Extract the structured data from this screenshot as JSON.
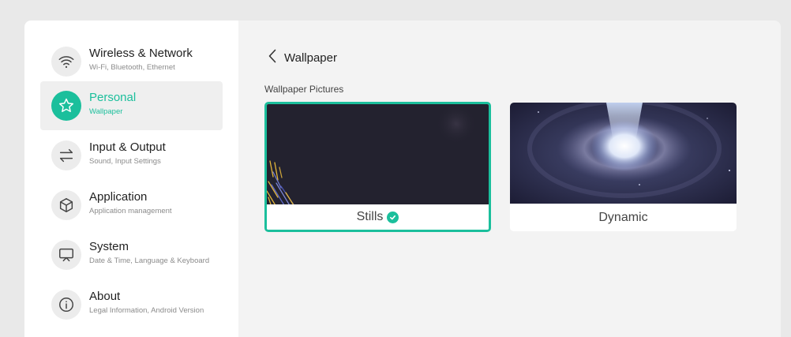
{
  "sidebar": {
    "items": [
      {
        "title": "Wireless & Network",
        "subtitle": "Wi-Fi, Bluetooth, Ethernet",
        "icon": "wifi-icon",
        "active": false
      },
      {
        "title": "Personal",
        "subtitle": "Wallpaper",
        "icon": "star-icon",
        "active": true
      },
      {
        "title": "Input & Output",
        "subtitle": "Sound, Input Settings",
        "icon": "swap-arrows-icon",
        "active": false
      },
      {
        "title": "Application",
        "subtitle": "Application management",
        "icon": "cube-icon",
        "active": false
      },
      {
        "title": "System",
        "subtitle": "Date & Time, Language & Keyboard",
        "icon": "monitor-icon",
        "active": false
      },
      {
        "title": "About",
        "subtitle": "Legal Information, Android Version",
        "icon": "info-icon",
        "active": false
      }
    ]
  },
  "content": {
    "back_icon": "chevron-left-icon",
    "title": "Wallpaper",
    "section_label": "Wallpaper Pictures",
    "cards": [
      {
        "label": "Stills",
        "selected": true
      },
      {
        "label": "Dynamic",
        "selected": false
      }
    ]
  },
  "colors": {
    "accent": "#1bbf9c",
    "page_background": "#e9e9e9",
    "panel_background": "#f3f3f3",
    "sidebar_background": "#ffffff"
  }
}
